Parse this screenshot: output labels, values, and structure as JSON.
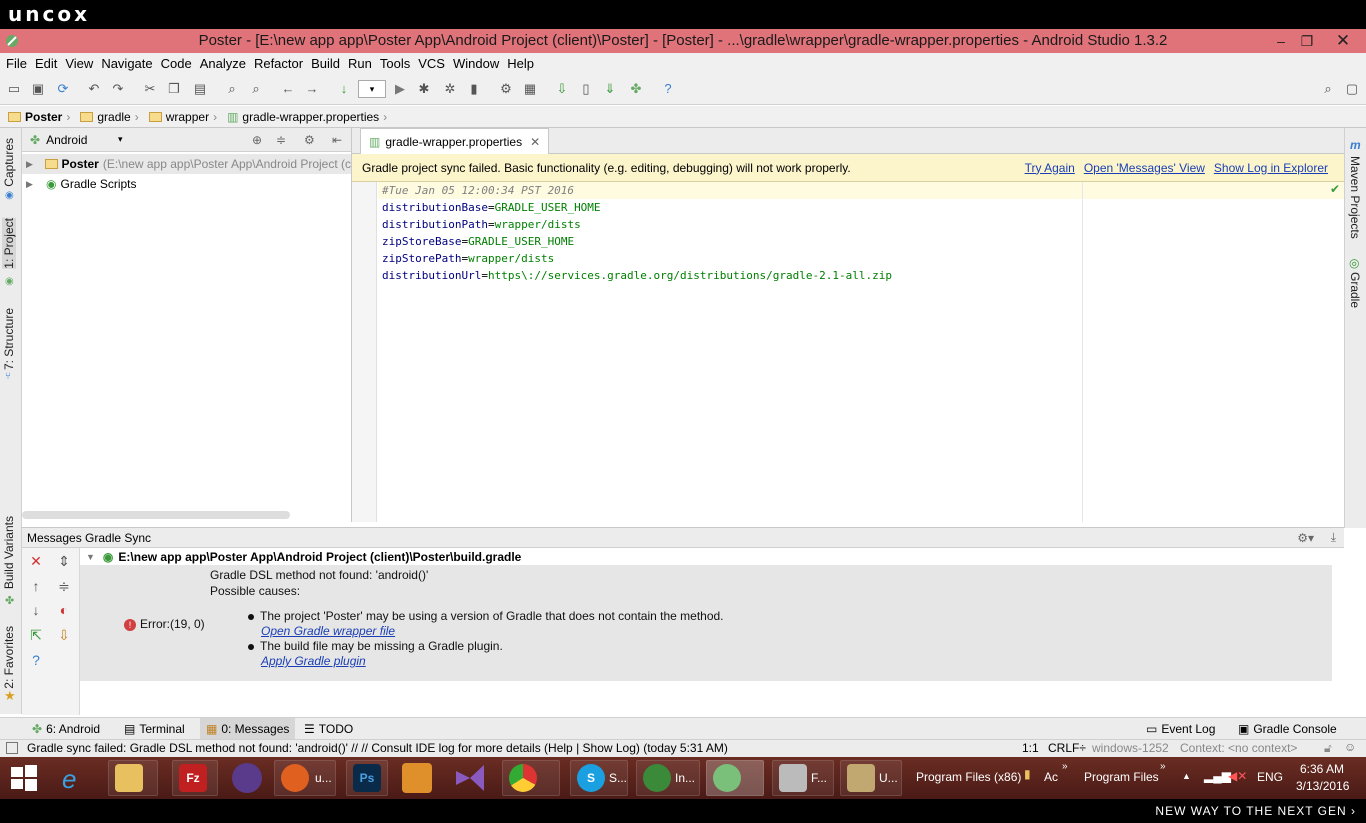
{
  "watermark": {
    "top": "uncox",
    "bottom": "NEW WAY TO THE NEXT GEN ›"
  },
  "window": {
    "title": "Poster - [E:\\new app app\\Poster App\\Android Project (client)\\Poster] - [Poster] - ...\\gradle\\wrapper\\gradle-wrapper.properties - Android Studio 1.3.2",
    "minimize": "–",
    "maximize": "❐",
    "close": "✕"
  },
  "menu": [
    "File",
    "Edit",
    "View",
    "Navigate",
    "Code",
    "Analyze",
    "Refactor",
    "Build",
    "Run",
    "Tools",
    "VCS",
    "Window",
    "Help"
  ],
  "breadcrumb": [
    "Poster",
    "gradle",
    "wrapper",
    "gradle-wrapper.properties"
  ],
  "left_tabs": {
    "captures": "Captures",
    "project": "1: Project",
    "structure": "7: Structure",
    "build_variants": "Build Variants",
    "favorites": "2: Favorites"
  },
  "right_tabs": {
    "maven": "Maven Projects",
    "gradle": "Gradle"
  },
  "project_panel": {
    "view_selector": "Android",
    "tree": [
      {
        "label": "Poster",
        "detail": "(E:\\new app app\\Poster App\\Android Project (c"
      },
      {
        "label": "Gradle Scripts",
        "detail": ""
      }
    ]
  },
  "editor": {
    "tab": "gradle-wrapper.properties",
    "banner": {
      "message": "Gradle project sync failed. Basic functionality (e.g. editing, debugging) will not work properly.",
      "try_again": "Try Again",
      "open_messages": "Open 'Messages' View",
      "show_log": "Show Log in Explorer"
    },
    "lines": [
      {
        "comment": "#Tue Jan 05 12:00:34 PST 2016"
      },
      {
        "key": "distributionBase",
        "value": "GRADLE_USER_HOME"
      },
      {
        "key": "distributionPath",
        "value": "wrapper/dists"
      },
      {
        "key": "zipStoreBase",
        "value": "GRADLE_USER_HOME"
      },
      {
        "key": "zipStorePath",
        "value": "wrapper/dists"
      },
      {
        "key": "distributionUrl",
        "value": "https\\://services.gradle.org/distributions/gradle-2.1-all.zip"
      }
    ]
  },
  "messages": {
    "title": "Messages Gradle Sync",
    "file": "E:\\new app app\\Poster App\\Android Project (client)\\Poster\\build.gradle",
    "error_label": "Error:(19, 0)",
    "line1": "Gradle DSL method not found: 'android()'",
    "line2": "Possible causes:",
    "cause1": "The project 'Poster' may be using a version of Gradle that does not contain the method.",
    "link1": "Open Gradle wrapper file",
    "cause2": "The build file may be missing a Gradle plugin.",
    "link2": "Apply Gradle plugin"
  },
  "bottom_tabs": {
    "android": "6: Android",
    "terminal": "Terminal",
    "messages": "0: Messages",
    "todo": "TODO",
    "event_log": "Event Log",
    "gradle_console": "Gradle Console"
  },
  "status": {
    "text": "Gradle sync failed: Gradle DSL method not found: 'android()' // // Consult IDE log for more details (Help | Show Log) (today 5:31 AM)",
    "position": "1:1",
    "line_sep": "CRLF÷",
    "encoding": "windows-1252",
    "context": "Context: <no context>"
  },
  "taskbar": {
    "items": [
      "u...",
      "S...",
      "In...",
      "F...",
      "U..."
    ],
    "folder1": "Program Files (x86)",
    "folder2": "Ac",
    "folder3": "Program Files",
    "lang": "ENG",
    "time": "6:36 AM",
    "date": "3/13/2016"
  }
}
